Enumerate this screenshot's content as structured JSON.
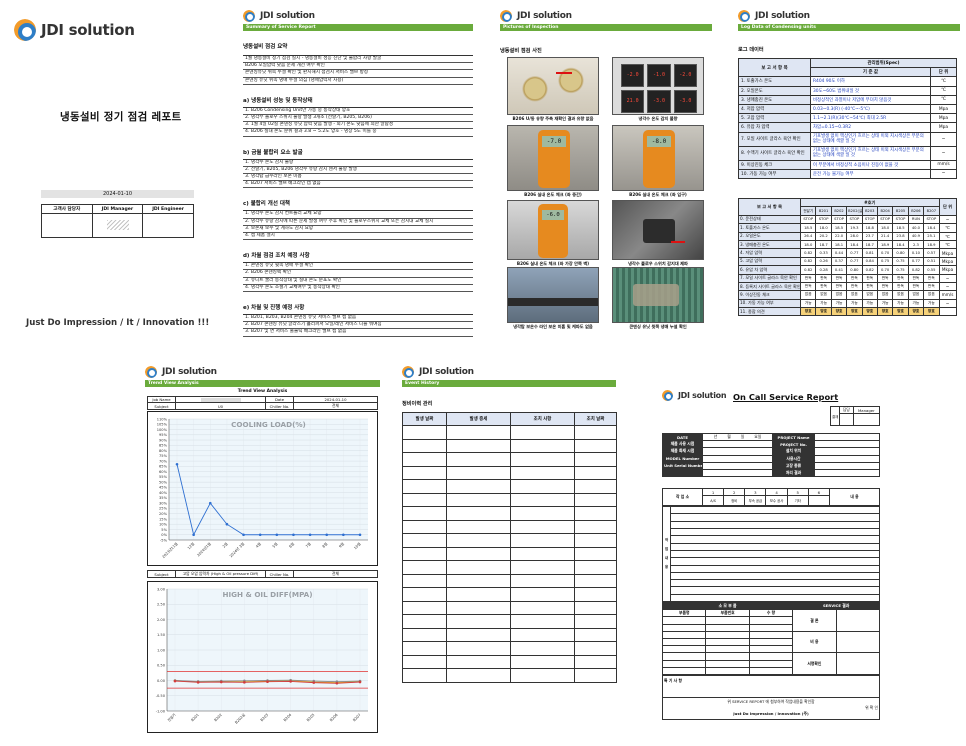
{
  "brand": "JDI solution",
  "cover": {
    "title": "냉동설비 정기 점검 레포트",
    "date": "2024-01-10",
    "sign_headers": [
      "고객사 담당자",
      "JDI Manager",
      "JDI Engineer"
    ],
    "slogan": "Just Do Impression / It / Innovation !!!"
  },
  "summary": {
    "bar": "Summary of Service Report",
    "heading": "냉동설비 점검 요약",
    "intro": [
      "1월 냉동설비 정기 점검 실시 - 냉동설비 성능 진단 및 불합리 사항 발굴",
      "B206 오일압력 낮음 문제 개선 여부 확인",
      "콘덴싱유닛 위쪽 누설 확인 및 판지해치 점검치 서비스 밸브 방청",
      "콘덴싱 유닛 위쪽 냉매 누설 의심 (냉매압력저 사용)"
    ],
    "sections": [
      {
        "title": "a)  냉동설비 성능 및 동작상태",
        "items": [
          "1. B206 Condensing Unit만 가동 중 동작상태 양호",
          "2. 냉각부 플로우 스위치 불량 발생 3개소 (전달기, B205, B206)",
          "3. 1월 4일 02실 콘덴싱 유닛 압력 낮음 발생 - 외기 온도 낮음에 의한 알람성",
          "4. B206 실내 온도 분위 결과 3.8 ~ 5.2도 양호 - 냉장 5도 이를 중"
        ]
      },
      {
        "title": "b)  금월 불합리 요소 발굴",
        "items": [
          "1. 냉각수 온도 감지 불량",
          "2. 전달기, B205, B206 냉각수 유량 감지 센서 불량 발생",
          "3. 냉각탑 급수라인 보온 미흡",
          "4. B207 서비스 밸브 배크라인 캡 없음"
        ]
      },
      {
        "title": "c)  불합리 개선 대책",
        "items": [
          "1. 냉각수 온도 감지 컨트롤러 교체 요망",
          "2. 냉각수 유량 감지에 따른 문제 발생 여부 주후 확인 및 플로우스위치 교체 또는 감지대 교체 실시",
          "3. 보온재 보수 및 계하도 감지 요망",
          "4. 캡 제품 설치"
        ]
      },
      {
        "title": "d)  차월 점검 조치 예정 사항",
        "items": [
          "1. 콘덴싱 유닛 윗쪽 냉매 누설 확인",
          "2. B206 콘덴싱팩 확인",
          "3. 유니트 쿨러 동작상태 및 실내 온도 분포도 확인",
          "4. 냉각수 온도 조절기 교체여부 및 동작상태 확인"
        ]
      },
      {
        "title": "e)  차월 및 진행 예정 사항",
        "items": [
          "1. B201, B203, B204 콘덴싱 유닛 서비스 밸브 캡 없음",
          "2. B207 콘덴싱 유닛 글라스기 흘러퍼서 오일/레인 서비스 니플 뭐여짐",
          "3. B207 및 면 서비스 출물틱 배크라인 밸브 캡 없음"
        ]
      }
    ]
  },
  "photos": {
    "bar": "Pictures of Inspection",
    "heading": "냉동설비 점검 사진",
    "captions": [
      "B206 U/동 유량 주축 재확인 결과 유량 없음",
      "냉각수 온도 감지 불량",
      "B206 실내 온도 체크 (좌 중간)",
      "B206 실내 온도 체크 (좌 입구)",
      "B206 실내 온도 체크 (좌 가장 안쪽 벽)",
      "냉각수 플로우 스위치 감지대 제파",
      "냉각탑 보온수 라인 보온 미흡 및 케파도 없음",
      "콘덴싱 유닛 윗쪽 냉매 누설 확인"
    ],
    "displays": [
      "-7.0",
      "-8.0",
      "-6.0",
      "-5.0"
    ],
    "panel_values": [
      "-2.0",
      "-1.0",
      "-2.0",
      "21.0",
      "-3.0",
      "-3.0"
    ]
  },
  "log": {
    "bar": "Log Data of Condensing units",
    "heading": "로그 데이터",
    "head": [
      "보 고 서 항 목",
      "관리범위(Spec)",
      "기 준 값",
      "단 위"
    ],
    "rows": [
      [
        "1. 토출가스 온도",
        "R404 90도 이하",
        "℃"
      ],
      [
        "2. 오일온도",
        "30도~60도 범위내일 것",
        "℃"
      ],
      [
        "3. 냉매충진 온도",
        "비정상적인 과열이나 저압에 무뎌치 않음것",
        "℃"
      ],
      [
        "4. 저압 압력",
        "0.03~0.3(R) (-40℃~-5℃)",
        "Mpa"
      ],
      [
        "5. 고압 압력",
        "1.1~2.1(R)(30℃~54℃)   최대 2.5R",
        "Mpa"
      ],
      [
        "6. 유압 차 압력",
        "차압=0.15~0.3R2",
        "Mpa"
      ],
      [
        "7. 모일 사이트 글라스 육안 확인",
        "기포발생 없이 액상인가 흐르는 상태 이외 지시색상은 무분의 없는 상태에 색깔 일 것",
        "~"
      ],
      [
        "8. 수액기 사이트 글라스 육안 확인",
        "기포발생 없이 액상인가 흐르는 상태 이외 지시색상은 무분의 없는 상태에 색깔 일 것",
        "~"
      ],
      [
        "9. 이상진동 체크",
        "이 부분에서 비정상적 소음이나 진동이 없을 것",
        "mm/s"
      ],
      [
        "10. 가동 가능 여부",
        "운전 가능 불가능 여부",
        "~"
      ]
    ],
    "head2": [
      "보 고 서 항 목",
      "#호기",
      "단 위"
    ],
    "units": [
      "전달기",
      "B201",
      "B202",
      "B202(실)",
      "B203",
      "B204",
      "B205",
      "B206",
      "B207"
    ],
    "rows2": [
      [
        "0. 운전상태",
        "STOP",
        "STOP",
        "STOP",
        "STOP",
        "STOP",
        "STOP",
        "STOP",
        "RUN",
        "STOP",
        "~"
      ],
      [
        "1. 토출가스 온도",
        "18.5",
        "18.0",
        "18.5",
        "19.3",
        "18.8",
        "18.0",
        "18.5",
        "40.0",
        "18.4",
        "℃"
      ],
      [
        "2. 오일온도",
        "26.4",
        "20.2",
        "22.0",
        "28.0",
        "23.7",
        "21.4",
        "23.8",
        "40.9",
        "25.1",
        "℃"
      ],
      [
        "3. 냉매충진 온도",
        "18.0",
        "18.7",
        "18.1",
        "18.4",
        "18.7",
        "18.9",
        "18.4",
        "2.3",
        "18.9",
        "℃"
      ],
      [
        "4. 저압 압력",
        "0.82",
        "0.33",
        "0.44",
        "0.77",
        "0.81",
        "0.70",
        "0.80",
        "0.10",
        "0.57",
        "Mkpa"
      ],
      [
        "5. 고압 압력",
        "0.82",
        "0.26",
        "0.37",
        "0.77",
        "0.84",
        "0.75",
        "0.75",
        "0.77",
        "0.51",
        "Mkpa"
      ],
      [
        "6. 유압 차 압력",
        "0.82",
        "0.28",
        "0.41",
        "0.80",
        "0.82",
        "0.70",
        "0.75",
        "0.82",
        "0.55",
        "Mkpa"
      ],
      [
        "7. 모일 사이트 글라스 육안 확인",
        "판독",
        "판독",
        "판독",
        "판독",
        "판독",
        "판독",
        "판독",
        "판독",
        "판독",
        "~"
      ],
      [
        "8. 등록지 사이트 글라스 육안 확인",
        "판독",
        "판독",
        "판독",
        "판독",
        "판독",
        "판독",
        "판독",
        "판독",
        "판독",
        "~"
      ],
      [
        "9. 이상진동 체크",
        "없음",
        "없음",
        "없음",
        "없음",
        "없음",
        "없음",
        "없음",
        "없음",
        "없음",
        "mm/s"
      ],
      [
        "10. 가동 가능 여부",
        "가능",
        "가능",
        "가능",
        "가능",
        "가능",
        "가능",
        "가능",
        "가능",
        "가능",
        "~"
      ],
      [
        "11. 종합 의견",
        "양호",
        "양호",
        "양호",
        "양호",
        "양호",
        "양호",
        "양호",
        "양호",
        "양호",
        ""
      ]
    ]
  },
  "trend": {
    "bar": "Trend View Analysis",
    "title": "Trend View Analysis",
    "job_name_label": "Job Name",
    "date_label": "Date",
    "date": "2024-01-10",
    "subject_label": "Subject",
    "subject_value": "U0",
    "chiller_label": "Chiller No.",
    "chiller_value": "전체",
    "subject2": "고압 오압 압력차 (High & Oil pressure Diff)",
    "chart1": {
      "title": "COOLING LOAD(%)",
      "yticks": [
        "110%",
        "105%",
        "100%",
        "95%",
        "90%",
        "85%",
        "80%",
        "75%",
        "70%",
        "65%",
        "60%",
        "55%",
        "50%",
        "45%",
        "40%",
        "35%",
        "30%",
        "25%",
        "20%",
        "15%",
        "10%",
        "5%",
        "0%",
        "-5%"
      ],
      "xticks": [
        "2023년11월",
        "12월",
        "2024년1월",
        "2월",
        "2024년 3월",
        "4월",
        "5월",
        "6월",
        "7월",
        "8월",
        "9월",
        "10월"
      ]
    },
    "chart2": {
      "title": "HIGH & OIL DIFF(MPA)",
      "yticks": [
        "3.00",
        "2.50",
        "2.00",
        "1.50",
        "1.00",
        "0.50",
        "0.00",
        "-0.50",
        "-1.00"
      ],
      "xticks": [
        "전달기",
        "B201",
        "B202",
        "B202실",
        "B203",
        "B204",
        "B205",
        "B206",
        "B207"
      ]
    }
  },
  "chart_data": [
    {
      "type": "line",
      "title": "COOLING LOAD(%)",
      "categories": [
        "2023년11월",
        "12월",
        "2024년1월",
        "2월",
        "2024년 3월",
        "4월",
        "5월",
        "6월",
        "7월",
        "8월",
        "9월",
        "10월"
      ],
      "values": [
        67,
        0,
        30,
        10,
        0,
        0,
        0,
        0,
        0,
        0,
        0,
        0
      ],
      "ylim": [
        -5,
        110
      ],
      "unit": "%",
      "color": "#2e6fd1"
    },
    {
      "type": "line",
      "title": "HIGH & OIL DIFF(MPA)",
      "categories": [
        "전달기",
        "B201",
        "B202",
        "B202실",
        "B203",
        "B204",
        "B205",
        "B206",
        "B207"
      ],
      "ylim": [
        -1.0,
        3.0
      ],
      "limits": [
        0.3,
        -0.25
      ],
      "series": [
        {
          "values": [
            0.0,
            -0.05,
            -0.03,
            -0.04,
            -0.02,
            0.0,
            -0.05,
            -0.07,
            -0.03
          ],
          "color": "#e6c330"
        },
        {
          "values": [
            0.0,
            -0.03,
            -0.02,
            -0.01,
            0.0,
            0.01,
            -0.02,
            -0.04,
            -0.02
          ],
          "color": "#888888"
        },
        {
          "values": [
            -0.02,
            -0.06,
            -0.05,
            -0.06,
            -0.04,
            -0.03,
            -0.07,
            -0.09,
            -0.05
          ],
          "color": "#d23c3c"
        }
      ]
    }
  ],
  "event": {
    "bar": "Event History",
    "heading": "정비이력 관리",
    "headers": [
      "발생 날짜",
      "발생 증세",
      "조치 사항",
      "조치 날짜"
    ]
  },
  "oncall": {
    "title": "On Call Service Report",
    "approve": [
      "담당",
      "Manager"
    ],
    "date_label": "DATE",
    "ymd": [
      "년",
      "월",
      "일",
      "요일"
    ],
    "left_labels": [
      "제품 사용 시점",
      "제품 화재 시점",
      "MODEL Number",
      "Unit Serial Number"
    ],
    "right_labels": [
      "PROJECT Name",
      "PROJECT No.",
      "설치 위치",
      "사용시간",
      "고장 종류",
      "처리 결과"
    ],
    "work_label": "작 업 소",
    "content_label": "내 용",
    "nums": [
      "1",
      "2",
      "3",
      "4",
      "5",
      "6"
    ],
    "kinds": [
      "A/S",
      "정비",
      "부속 공급",
      "보수 공사",
      "기타"
    ],
    "situation": "작 업 내 용",
    "parts_head": "소 모 부 품",
    "part_cols": [
      "부품명",
      "부품번호",
      "수 량"
    ],
    "service_head": "SERVICE 결과",
    "service_rows": [
      "결 론",
      "비 용",
      "서명확인"
    ],
    "special": "특 기 사 항",
    "confirm": "위 SERVICE REPORT 에 첨부하여 작업내용을 확인함",
    "confirm2": "위 확 인",
    "footer": "Just Do Impression / Innovation (주)"
  }
}
